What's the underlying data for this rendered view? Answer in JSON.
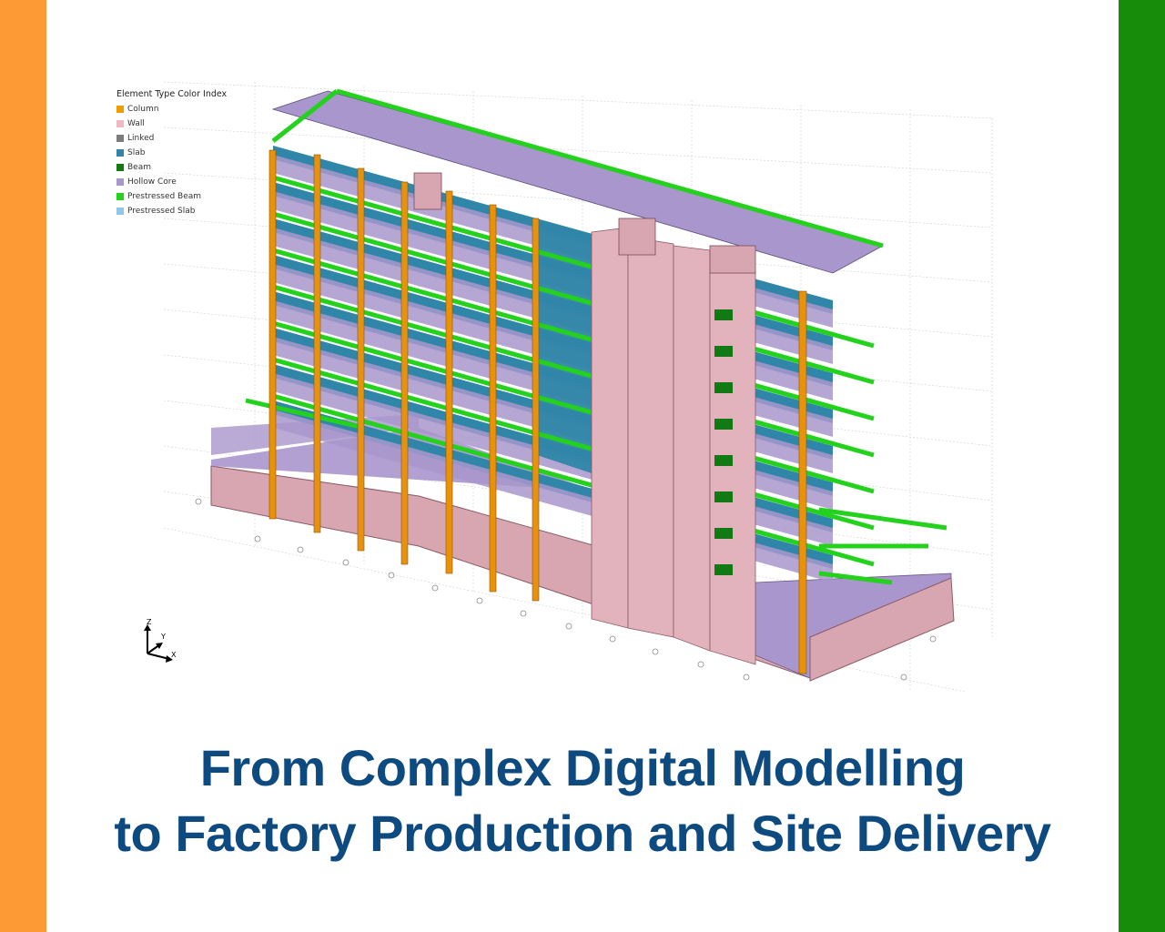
{
  "colors": {
    "left_bar": "#fd9a35",
    "right_bar": "#168c0a",
    "headline": "#0d4a80",
    "grid": "#c8c8c8"
  },
  "legend": {
    "title": "Element Type Color Index",
    "items": [
      {
        "label": "Column",
        "color": "#f29b0a"
      },
      {
        "label": "Wall",
        "color": "#f2b8c3"
      },
      {
        "label": "Linked",
        "color": "#7c7c7c"
      },
      {
        "label": "Slab",
        "color": "#2f86a8"
      },
      {
        "label": "Beam",
        "color": "#117a12"
      },
      {
        "label": "Hollow Core",
        "color": "#a996cc"
      },
      {
        "label": "Prestressed Beam",
        "color": "#24d11c"
      },
      {
        "label": "Prestressed Slab",
        "color": "#8cc9e8"
      }
    ]
  },
  "axes": {
    "z": "Z",
    "y": "Y",
    "x": "X"
  },
  "headline": {
    "line1": "From Complex Digital Modelling",
    "line2": "to Factory Production and Site Delivery"
  }
}
